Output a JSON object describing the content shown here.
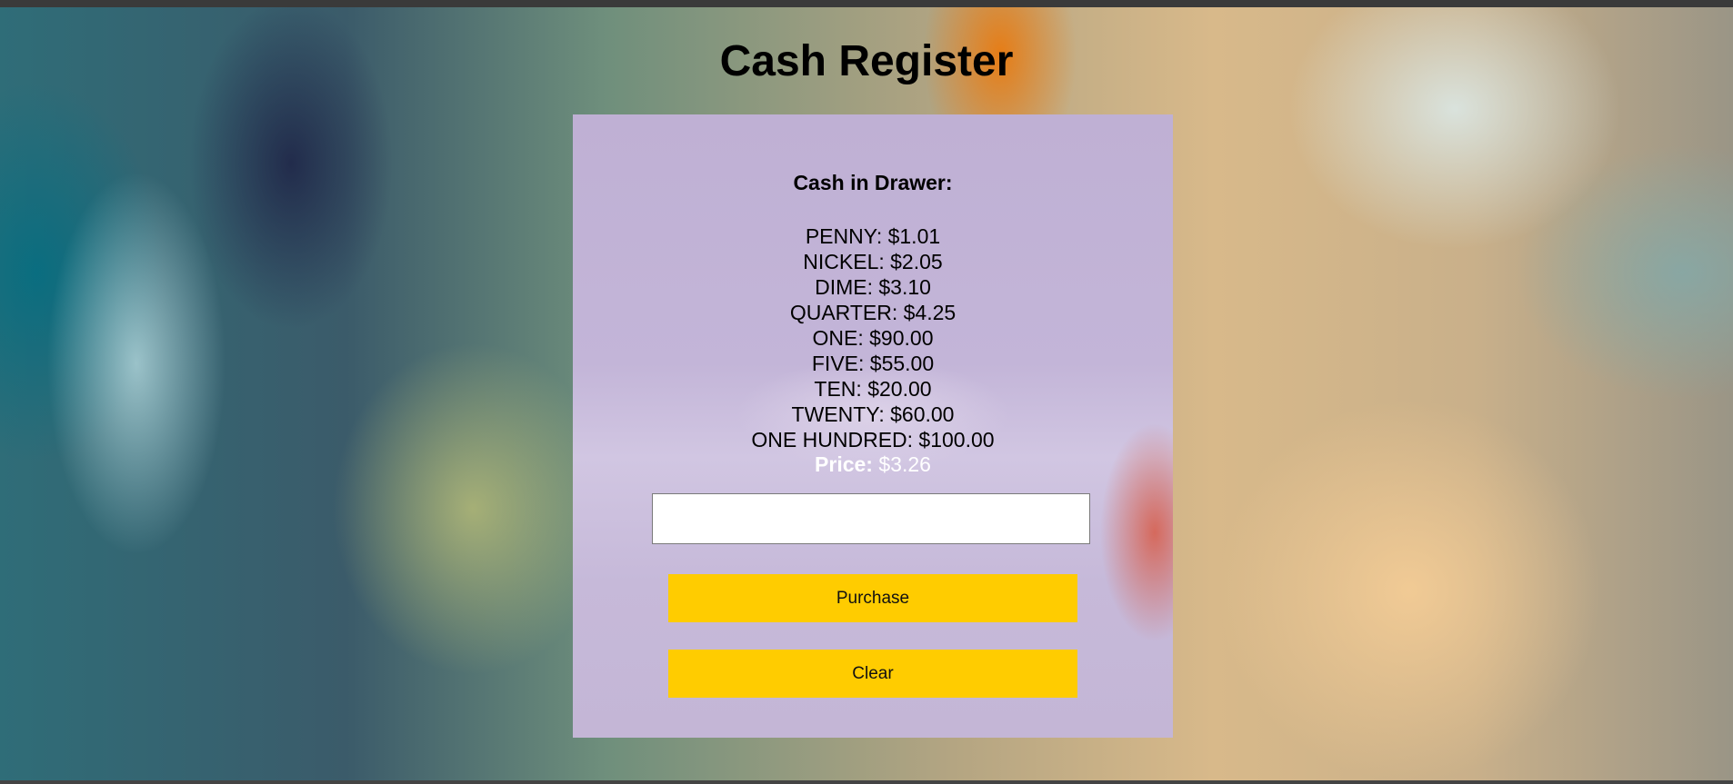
{
  "page": {
    "title": "Cash Register"
  },
  "drawer": {
    "heading": "Cash in Drawer:",
    "items": [
      "PENNY: $1.01",
      "NICKEL: $2.05",
      "DIME: $3.10",
      "QUARTER: $4.25",
      "ONE: $90.00",
      "FIVE: $55.00",
      "TEN: $20.00",
      "TWENTY: $60.00",
      "ONE HUNDRED: $100.00"
    ]
  },
  "price": {
    "label": "Price:",
    "value": "$3.26"
  },
  "cash_input": {
    "value": "",
    "placeholder": ""
  },
  "buttons": {
    "purchase_label": "Purchase",
    "clear_label": "Clear"
  },
  "colors": {
    "button_accent": "#ffcc00",
    "panel": "#c3b5d8",
    "price_text": "#ffffff"
  }
}
